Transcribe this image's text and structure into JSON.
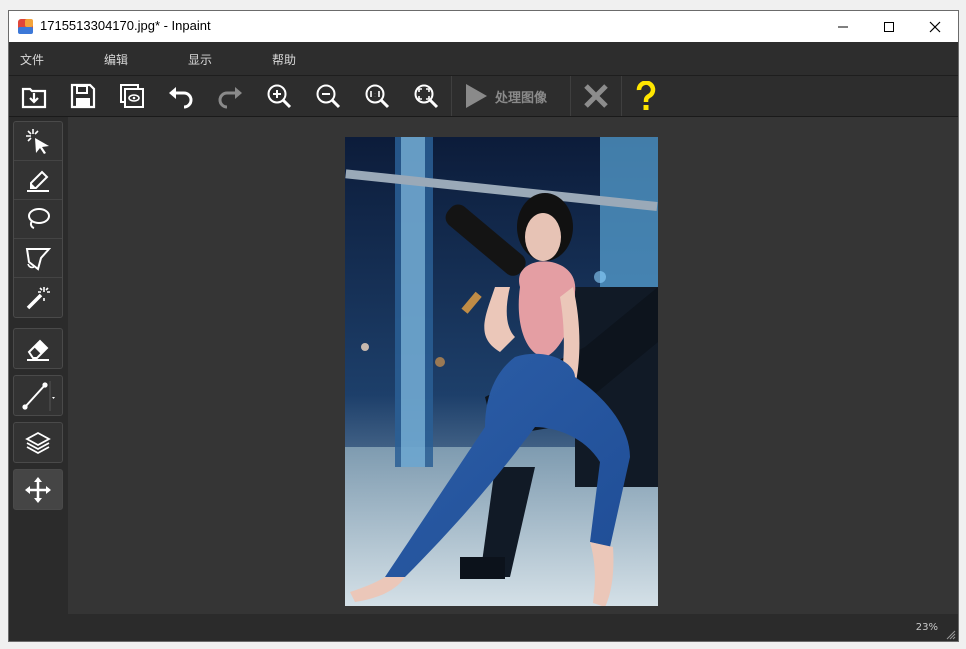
{
  "window": {
    "title": "1715513304170.jpg* - Inpaint",
    "icon": "inpaint-app-icon"
  },
  "menu": {
    "items": [
      "文件",
      "编辑",
      "显示",
      "帮助"
    ]
  },
  "toolbar": {
    "buttons": [
      "open-icon",
      "save-icon",
      "save-copy-icon",
      "undo-icon",
      "redo-icon",
      "zoom-in-icon",
      "zoom-out-icon",
      "zoom-actual-icon",
      "zoom-fit-icon"
    ],
    "process_label": "处理图像",
    "cancel": "close-x-icon",
    "help": "help-question-icon"
  },
  "tools": [
    "smart-select-icon",
    "marker-icon",
    "lasso-icon",
    "polygon-lasso-icon",
    "magic-wand-icon",
    "eraser-icon",
    "line-tool-icon",
    "layers-icon",
    "move-icon"
  ],
  "colors": {
    "background": "#2b2b2b",
    "canvas": "#353535",
    "help": "#ffe600",
    "cancel": "#8c8c8c"
  },
  "status": {
    "zoom": "23%"
  }
}
